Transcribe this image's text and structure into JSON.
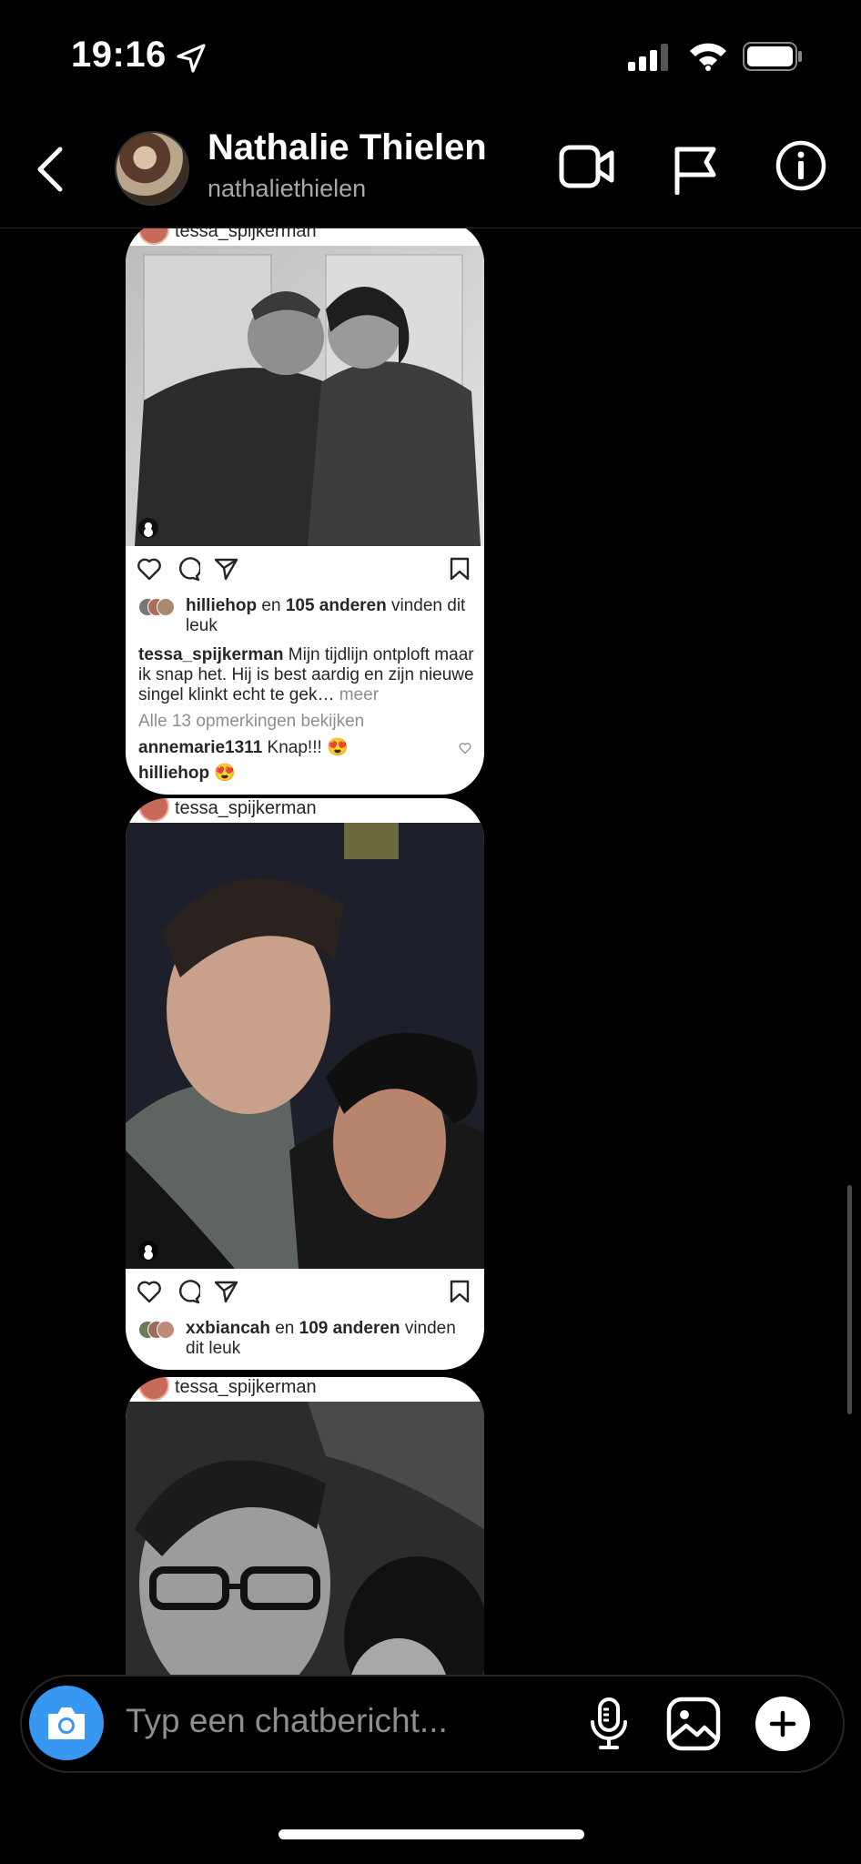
{
  "status_bar": {
    "time": "19:16"
  },
  "header": {
    "name": "Nathalie Thielen",
    "username": "nathaliethielen"
  },
  "posts": [
    {
      "author": "tessa_spijkerman",
      "liked_by": "hilliehop",
      "likes_mid": " en ",
      "likes_count": "105 anderen",
      "likes_suffix": " vinden dit leuk",
      "caption_author": "tessa_spijkerman",
      "caption": " Mijn tijdlijn ontploft maar ik snap het. Hij is best aardig en zijn nieuwe singel klinkt echt te gek…",
      "more": " meer",
      "view_comments": "Alle 13 opmerkingen bekijken",
      "comment_user": "annemarie1311",
      "comment_text": " Knap!!! 😍",
      "comment2_user": "hilliehop",
      "comment2_text": " 😍"
    },
    {
      "author": "tessa_spijkerman",
      "liked_by": "xxbiancah",
      "likes_mid": " en ",
      "likes_count": "109 anderen",
      "likes_suffix": " vinden dit leuk"
    },
    {
      "author": "tessa_spijkerman"
    }
  ],
  "composer": {
    "placeholder": "Typ een chatbericht..."
  },
  "colors": {
    "accent": "#3897f0",
    "background": "#000000",
    "card": "#ffffff"
  },
  "icons": [
    "location-arrow-icon",
    "signal-icon",
    "wifi-icon",
    "battery-icon",
    "back-chevron-icon",
    "video-call-icon",
    "flag-icon",
    "info-icon",
    "heart-icon",
    "comment-icon",
    "share-icon",
    "bookmark-icon",
    "camera-icon",
    "microphone-icon",
    "gallery-icon",
    "plus-icon"
  ]
}
